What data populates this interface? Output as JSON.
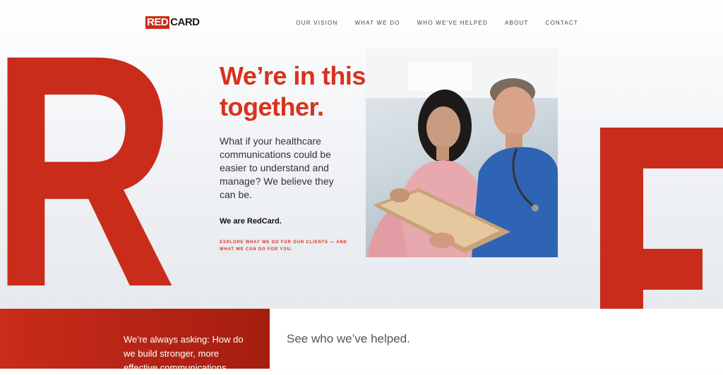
{
  "brand": {
    "logo_red": "RED",
    "logo_card": "CARD"
  },
  "nav": {
    "items": [
      {
        "label": "OUR VISION"
      },
      {
        "label": "WHAT WE DO"
      },
      {
        "label": "WHO WE'VE HELPED"
      },
      {
        "label": "ABOUT"
      },
      {
        "label": "CONTACT"
      }
    ]
  },
  "hero": {
    "big_letter_left": "R",
    "heading": "We’re in this together.",
    "lead": "What if your healthcare communications could be easier to understand and manage? We believe they can be.",
    "we_are": "We are RedCard.",
    "explore_link": "EXPLORE WHAT WE DO FOR OUR CLIENTS — AND WHAT WE CAN DO FOR YOU."
  },
  "colors": {
    "brand_red": "#c92c1a",
    "heading_red": "#d9321d"
  },
  "bottom": {
    "red_panel_text": "We’re always asking: How do we build stronger, more effective communications",
    "helped_heading": "See who we’ve helped."
  }
}
